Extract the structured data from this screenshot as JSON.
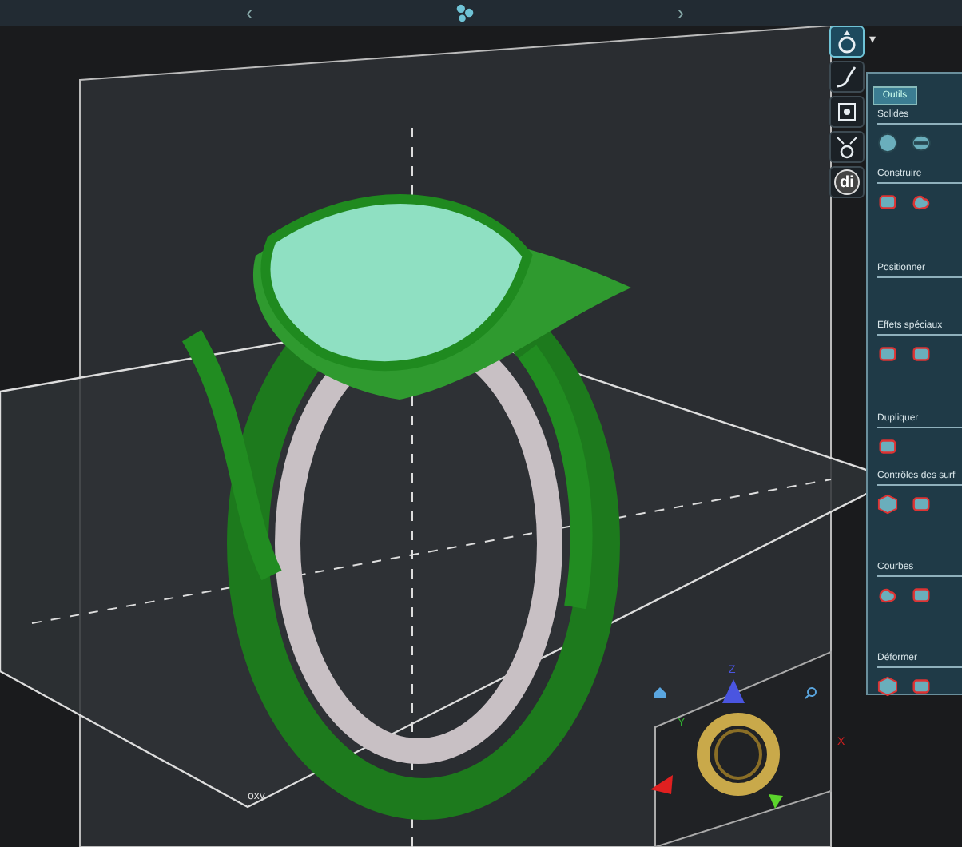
{
  "nav": {
    "prev": "‹",
    "next": "›"
  },
  "tool_icons": [
    {
      "kind": "ring",
      "selected": true
    },
    {
      "kind": "pen",
      "selected": false
    },
    {
      "kind": "mesh",
      "selected": false
    },
    {
      "kind": "gem",
      "selected": false
    },
    {
      "kind": "text",
      "label": "di",
      "selected": false
    }
  ],
  "panel": {
    "menu_caret": "▾",
    "tab": "Outils",
    "sections": [
      {
        "title": "Solides",
        "icons": [
          {
            "kind": "sphere"
          },
          {
            "kind": "ellipsoid"
          }
        ]
      },
      {
        "title": "Construire",
        "icons": [
          {
            "kind": "box"
          },
          {
            "kind": "blob"
          }
        ]
      },
      {
        "title": "Positionner"
      },
      {
        "title": "Effets spéciaux",
        "icons": [
          {
            "kind": "box"
          },
          {
            "kind": "box"
          }
        ]
      },
      {
        "title": "Dupliquer",
        "icons": [
          {
            "kind": "box"
          }
        ]
      },
      {
        "title": "Contrôles des surf",
        "icons": [
          {
            "kind": "hexagon"
          },
          {
            "kind": "box"
          }
        ]
      },
      {
        "title": "Courbes",
        "icons": [
          {
            "kind": "blob"
          },
          {
            "kind": "box"
          }
        ]
      },
      {
        "title": "Déformer",
        "icons": [
          {
            "kind": "hexagon"
          },
          {
            "kind": "box"
          }
        ]
      }
    ]
  },
  "viewport": {
    "plane_label": "oxy",
    "gizmo": {
      "z": "Z",
      "y": "Y",
      "x": "X"
    }
  }
}
